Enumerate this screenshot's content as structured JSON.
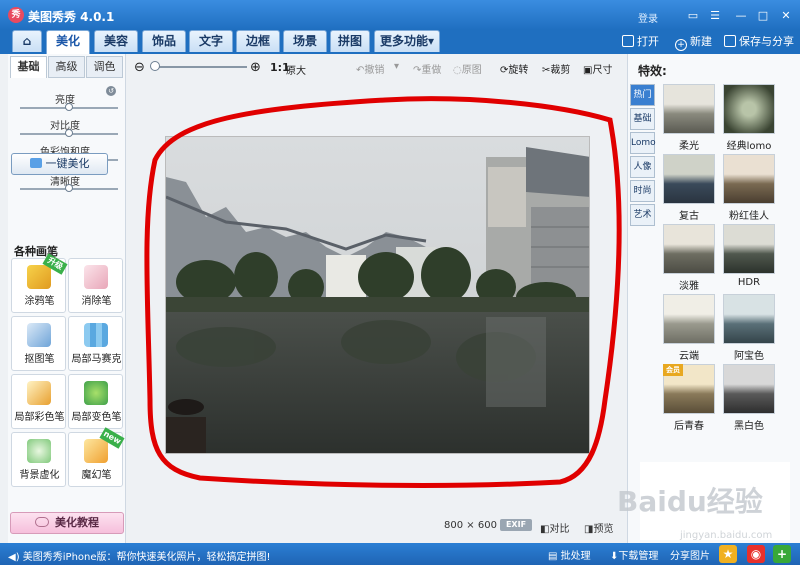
{
  "titlebar": {
    "app_title": "美图秀秀 4.0.1",
    "logo_text": "秀",
    "login": "登录"
  },
  "nav": {
    "tabs": [
      "美化",
      "美容",
      "饰品",
      "文字",
      "边框",
      "场景",
      "拼图",
      "更多功能▾"
    ],
    "active_tab": "美化",
    "open": "打开",
    "new": "新建",
    "save_share": "保存与分享"
  },
  "left": {
    "subtabs": [
      "基础",
      "高级",
      "调色"
    ],
    "sliders": [
      {
        "label": "亮度",
        "value": 0.5
      },
      {
        "label": "对比度",
        "value": 0.5
      },
      {
        "label": "色彩饱和度",
        "value": 0.5
      },
      {
        "label": "清晰度",
        "value": 0.5
      }
    ],
    "auto_beautify": "一键美化",
    "brush_header": "各种画笔",
    "brushes": [
      {
        "label": "涂鸦笔",
        "badge": "升级"
      },
      {
        "label": "消除笔",
        "badge": ""
      },
      {
        "label": "抠图笔",
        "badge": ""
      },
      {
        "label": "局部马赛克",
        "badge": ""
      },
      {
        "label": "局部彩色笔",
        "badge": ""
      },
      {
        "label": "局部变色笔",
        "badge": ""
      },
      {
        "label": "背景虚化",
        "badge": ""
      },
      {
        "label": "魔幻笔",
        "badge": "new"
      }
    ],
    "tutorial": "美化教程"
  },
  "toolbar": {
    "ratio": "1:1",
    "original_size": "原大",
    "undo": "撤销",
    "redo": "重做",
    "restore": "原图",
    "rotate": "旋转",
    "crop": "裁剪",
    "resize": "尺寸"
  },
  "canvas": {
    "width_px": "800",
    "height_px": "600",
    "exif": "EXIF",
    "compare": "对比",
    "preview": "预览"
  },
  "right": {
    "header": "特效:",
    "categories": [
      "热门",
      "基础",
      "Lomo",
      "人像",
      "时尚",
      "艺术"
    ],
    "active_category": "热门",
    "effects": [
      {
        "label": "柔光",
        "hot": ""
      },
      {
        "label": "经典lomo",
        "hot": ""
      },
      {
        "label": "复古",
        "hot": ""
      },
      {
        "label": "粉红佳人",
        "hot": ""
      },
      {
        "label": "淡雅",
        "hot": ""
      },
      {
        "label": "HDR",
        "hot": ""
      },
      {
        "label": "云端",
        "hot": ""
      },
      {
        "label": "阿宝色",
        "hot": ""
      },
      {
        "label": "后青春",
        "hot": "会员"
      },
      {
        "label": "黑白色",
        "hot": ""
      }
    ]
  },
  "status": {
    "message": "美图秀秀iPhone版：帮你快速美化照片，轻松搞定拼图!",
    "batch": "批处理",
    "download": "下载管理",
    "share": "分享图片"
  },
  "watermark": {
    "brand": "Baidu经验",
    "url": "jingyan.baidu.com"
  },
  "colors": {
    "accent": "#1f6fc0",
    "loop": "#e00000"
  }
}
